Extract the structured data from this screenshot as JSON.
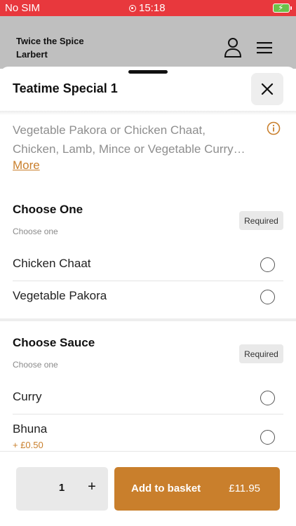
{
  "status_bar": {
    "carrier": "No SIM",
    "time": "15:18"
  },
  "header": {
    "store_name": "Twice the Spice Larbert"
  },
  "item": {
    "title": "Teatime Special 1",
    "description_lines": [
      "Vegetable Pakora or Chicken Chaat,",
      "Chicken, Lamb, Mince or Vegetable Curry…"
    ],
    "more_label": "More"
  },
  "groups": [
    {
      "title": "Choose One",
      "subtitle": "Choose one",
      "badge": "Required",
      "options": [
        {
          "label": "Chicken Chaat"
        },
        {
          "label": "Vegetable Pakora"
        }
      ]
    },
    {
      "title": "Choose Sauce",
      "subtitle": "Choose one",
      "badge": "Required",
      "options": [
        {
          "label": "Curry"
        },
        {
          "label": "Bhuna",
          "price": "+ £0.50"
        }
      ]
    }
  ],
  "footer": {
    "quantity": "1",
    "plus_label": "+",
    "add_label": "Add to basket",
    "total": "£11.95"
  },
  "colors": {
    "status_bar": "#e8383d",
    "accent": "#c97f2c",
    "header_bg": "#bfbfbf"
  },
  "icons": [
    "record-icon",
    "battery-icon",
    "user-icon",
    "menu-icon",
    "close-icon",
    "info-icon",
    "radio-icon"
  ]
}
